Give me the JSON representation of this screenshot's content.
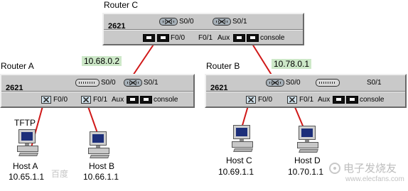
{
  "routers": {
    "c": {
      "name": "Router C",
      "model": "2621",
      "ports": {
        "s00": "S0/0",
        "s01": "S0/1",
        "f00": "F0/0",
        "f01": "F0/1",
        "aux": "Aux",
        "console": "console"
      }
    },
    "a": {
      "name": "Router A",
      "model": "2621",
      "ports": {
        "s00": "S0/0",
        "s01": "S0/1",
        "f00": "F0/0",
        "f01": "F0/1",
        "aux": "Aux",
        "console": "console"
      }
    },
    "b": {
      "name": "Router B",
      "model": "2621",
      "ports": {
        "s00": "S0/0",
        "s01": "S0/1",
        "f00": "F0/0",
        "f01": "F0/1",
        "aux": "Aux",
        "console": "console"
      }
    }
  },
  "links": {
    "ac_ip": "10.68.0.2",
    "bc_ip": "10.78.0.1"
  },
  "hosts": [
    {
      "id": "a",
      "tag": "TFTP",
      "name": "Host A",
      "ip": "10.65.1.1"
    },
    {
      "id": "b",
      "tag": "",
      "name": "Host B",
      "ip": "10.66.1.1"
    },
    {
      "id": "c",
      "tag": "",
      "name": "Host C",
      "ip": "10.69.1.1"
    },
    {
      "id": "d",
      "tag": "",
      "name": "Host D",
      "ip": "10.70.1.1"
    }
  ],
  "watermark": {
    "brand": "百度",
    "site": "电子发烧友",
    "url": "www.elecfans.com"
  },
  "colors": {
    "link": "#d01818",
    "chassis": "#c9c9c9",
    "ip_tag_bg": "#cde8c8"
  }
}
